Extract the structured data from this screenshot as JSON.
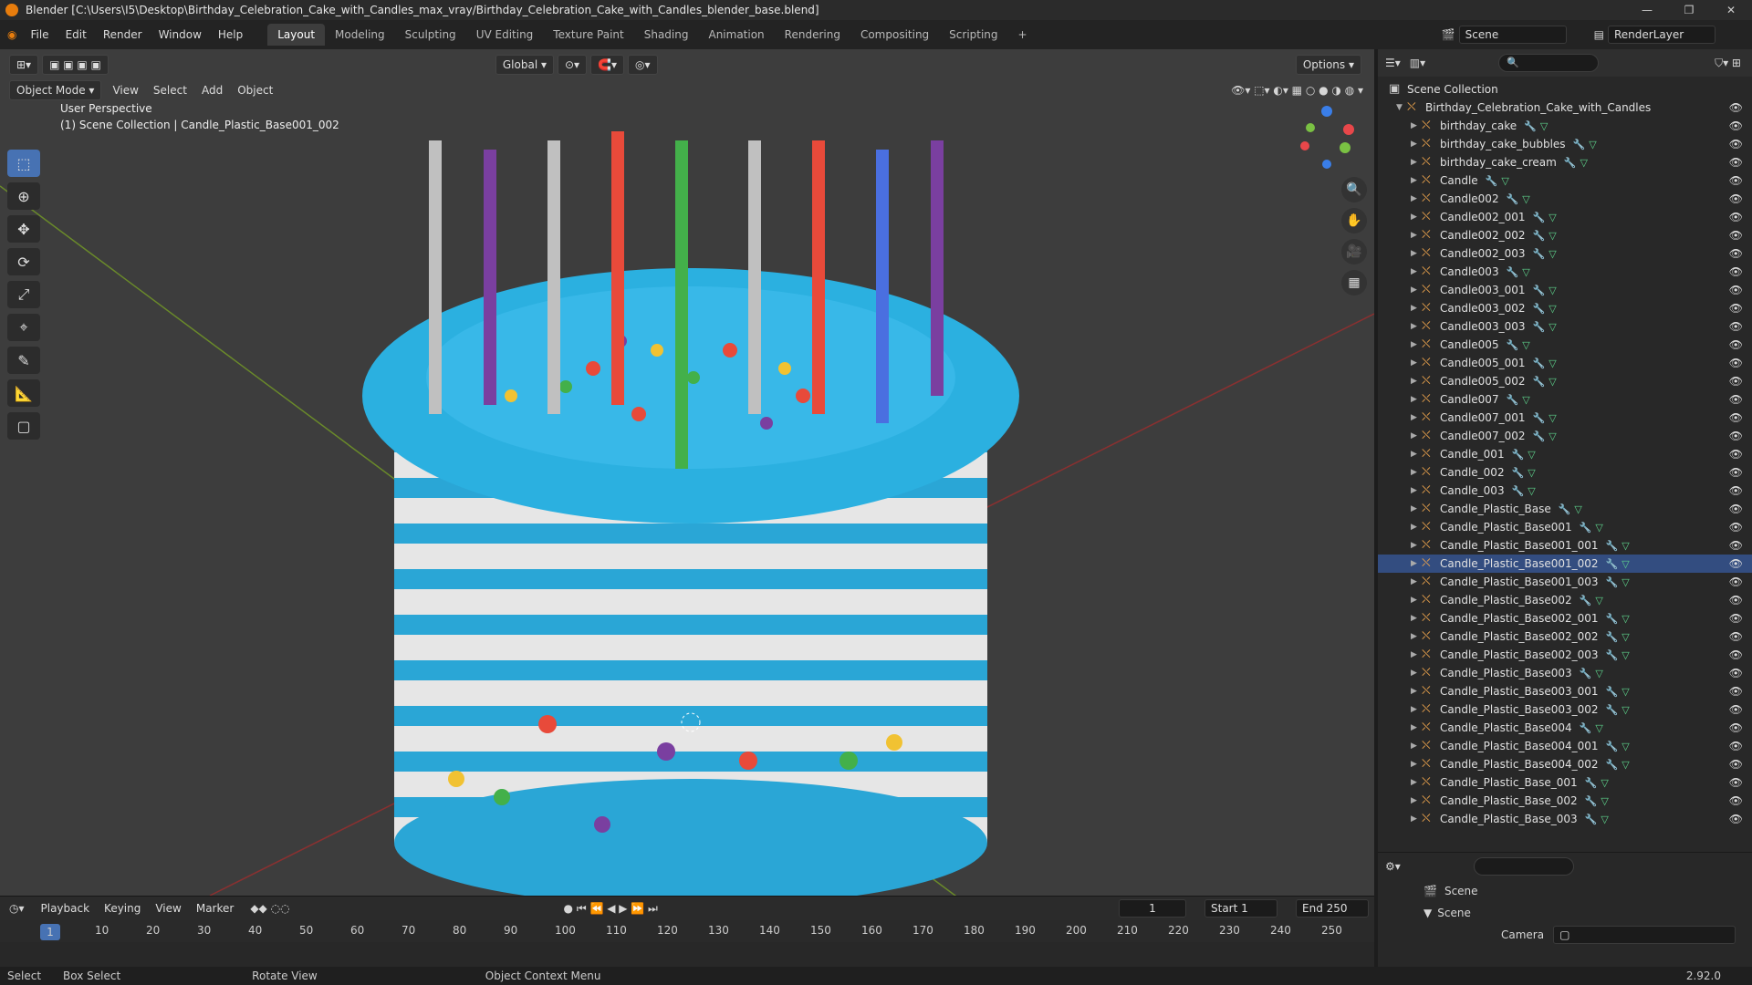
{
  "window": {
    "title": "Blender [C:\\Users\\I5\\Desktop\\Birthday_Celebration_Cake_with_Candles_max_vray/Birthday_Celebration_Cake_with_Candles_blender_base.blend]",
    "version": "2.92.0"
  },
  "menu": [
    "File",
    "Edit",
    "Render",
    "Window",
    "Help"
  ],
  "workspaces": [
    "Layout",
    "Modeling",
    "Sculpting",
    "UV Editing",
    "Texture Paint",
    "Shading",
    "Animation",
    "Rendering",
    "Compositing",
    "Scripting"
  ],
  "scene": {
    "scene_name": "Scene",
    "render_layer": "RenderLayer"
  },
  "viewport": {
    "mode": "Object Mode",
    "menus": [
      "View",
      "Select",
      "Add",
      "Object"
    ],
    "orientation": "Global",
    "options": "Options",
    "perspective": "User Perspective",
    "collection_info": "(1) Scene Collection | Candle_Plastic_Base001_002"
  },
  "outliner": {
    "root": "Scene Collection",
    "collection": "Birthday_Celebration_Cake_with_Candles",
    "items": [
      "birthday_cake",
      "birthday_cake_bubbles",
      "birthday_cake_cream",
      "Candle",
      "Candle002",
      "Candle002_001",
      "Candle002_002",
      "Candle002_003",
      "Candle003",
      "Candle003_001",
      "Candle003_002",
      "Candle003_003",
      "Candle005",
      "Candle005_001",
      "Candle005_002",
      "Candle007",
      "Candle007_001",
      "Candle007_002",
      "Candle_001",
      "Candle_002",
      "Candle_003",
      "Candle_Plastic_Base",
      "Candle_Plastic_Base001",
      "Candle_Plastic_Base001_001",
      "Candle_Plastic_Base001_002",
      "Candle_Plastic_Base001_003",
      "Candle_Plastic_Base002",
      "Candle_Plastic_Base002_001",
      "Candle_Plastic_Base002_002",
      "Candle_Plastic_Base002_003",
      "Candle_Plastic_Base003",
      "Candle_Plastic_Base003_001",
      "Candle_Plastic_Base003_002",
      "Candle_Plastic_Base004",
      "Candle_Plastic_Base004_001",
      "Candle_Plastic_Base004_002",
      "Candle_Plastic_Base_001",
      "Candle_Plastic_Base_002",
      "Candle_Plastic_Base_003"
    ],
    "selected": "Candle_Plastic_Base001_002"
  },
  "properties": {
    "title": "Scene",
    "section": "Scene",
    "camera_label": "Camera"
  },
  "timeline": {
    "menus": [
      "Playback",
      "Keying",
      "View",
      "Marker"
    ],
    "current_frame": "1",
    "start_label": "Start",
    "start": "1",
    "end_label": "End",
    "end": "250",
    "ticks": [
      "1",
      "10",
      "20",
      "30",
      "40",
      "50",
      "60",
      "70",
      "80",
      "90",
      "100",
      "110",
      "120",
      "130",
      "140",
      "150",
      "160",
      "170",
      "180",
      "190",
      "200",
      "210",
      "220",
      "230",
      "240",
      "250"
    ]
  },
  "status": {
    "select": "Select",
    "box_select": "Box Select",
    "rotate_view": "Rotate View",
    "context_menu": "Object Context Menu"
  }
}
